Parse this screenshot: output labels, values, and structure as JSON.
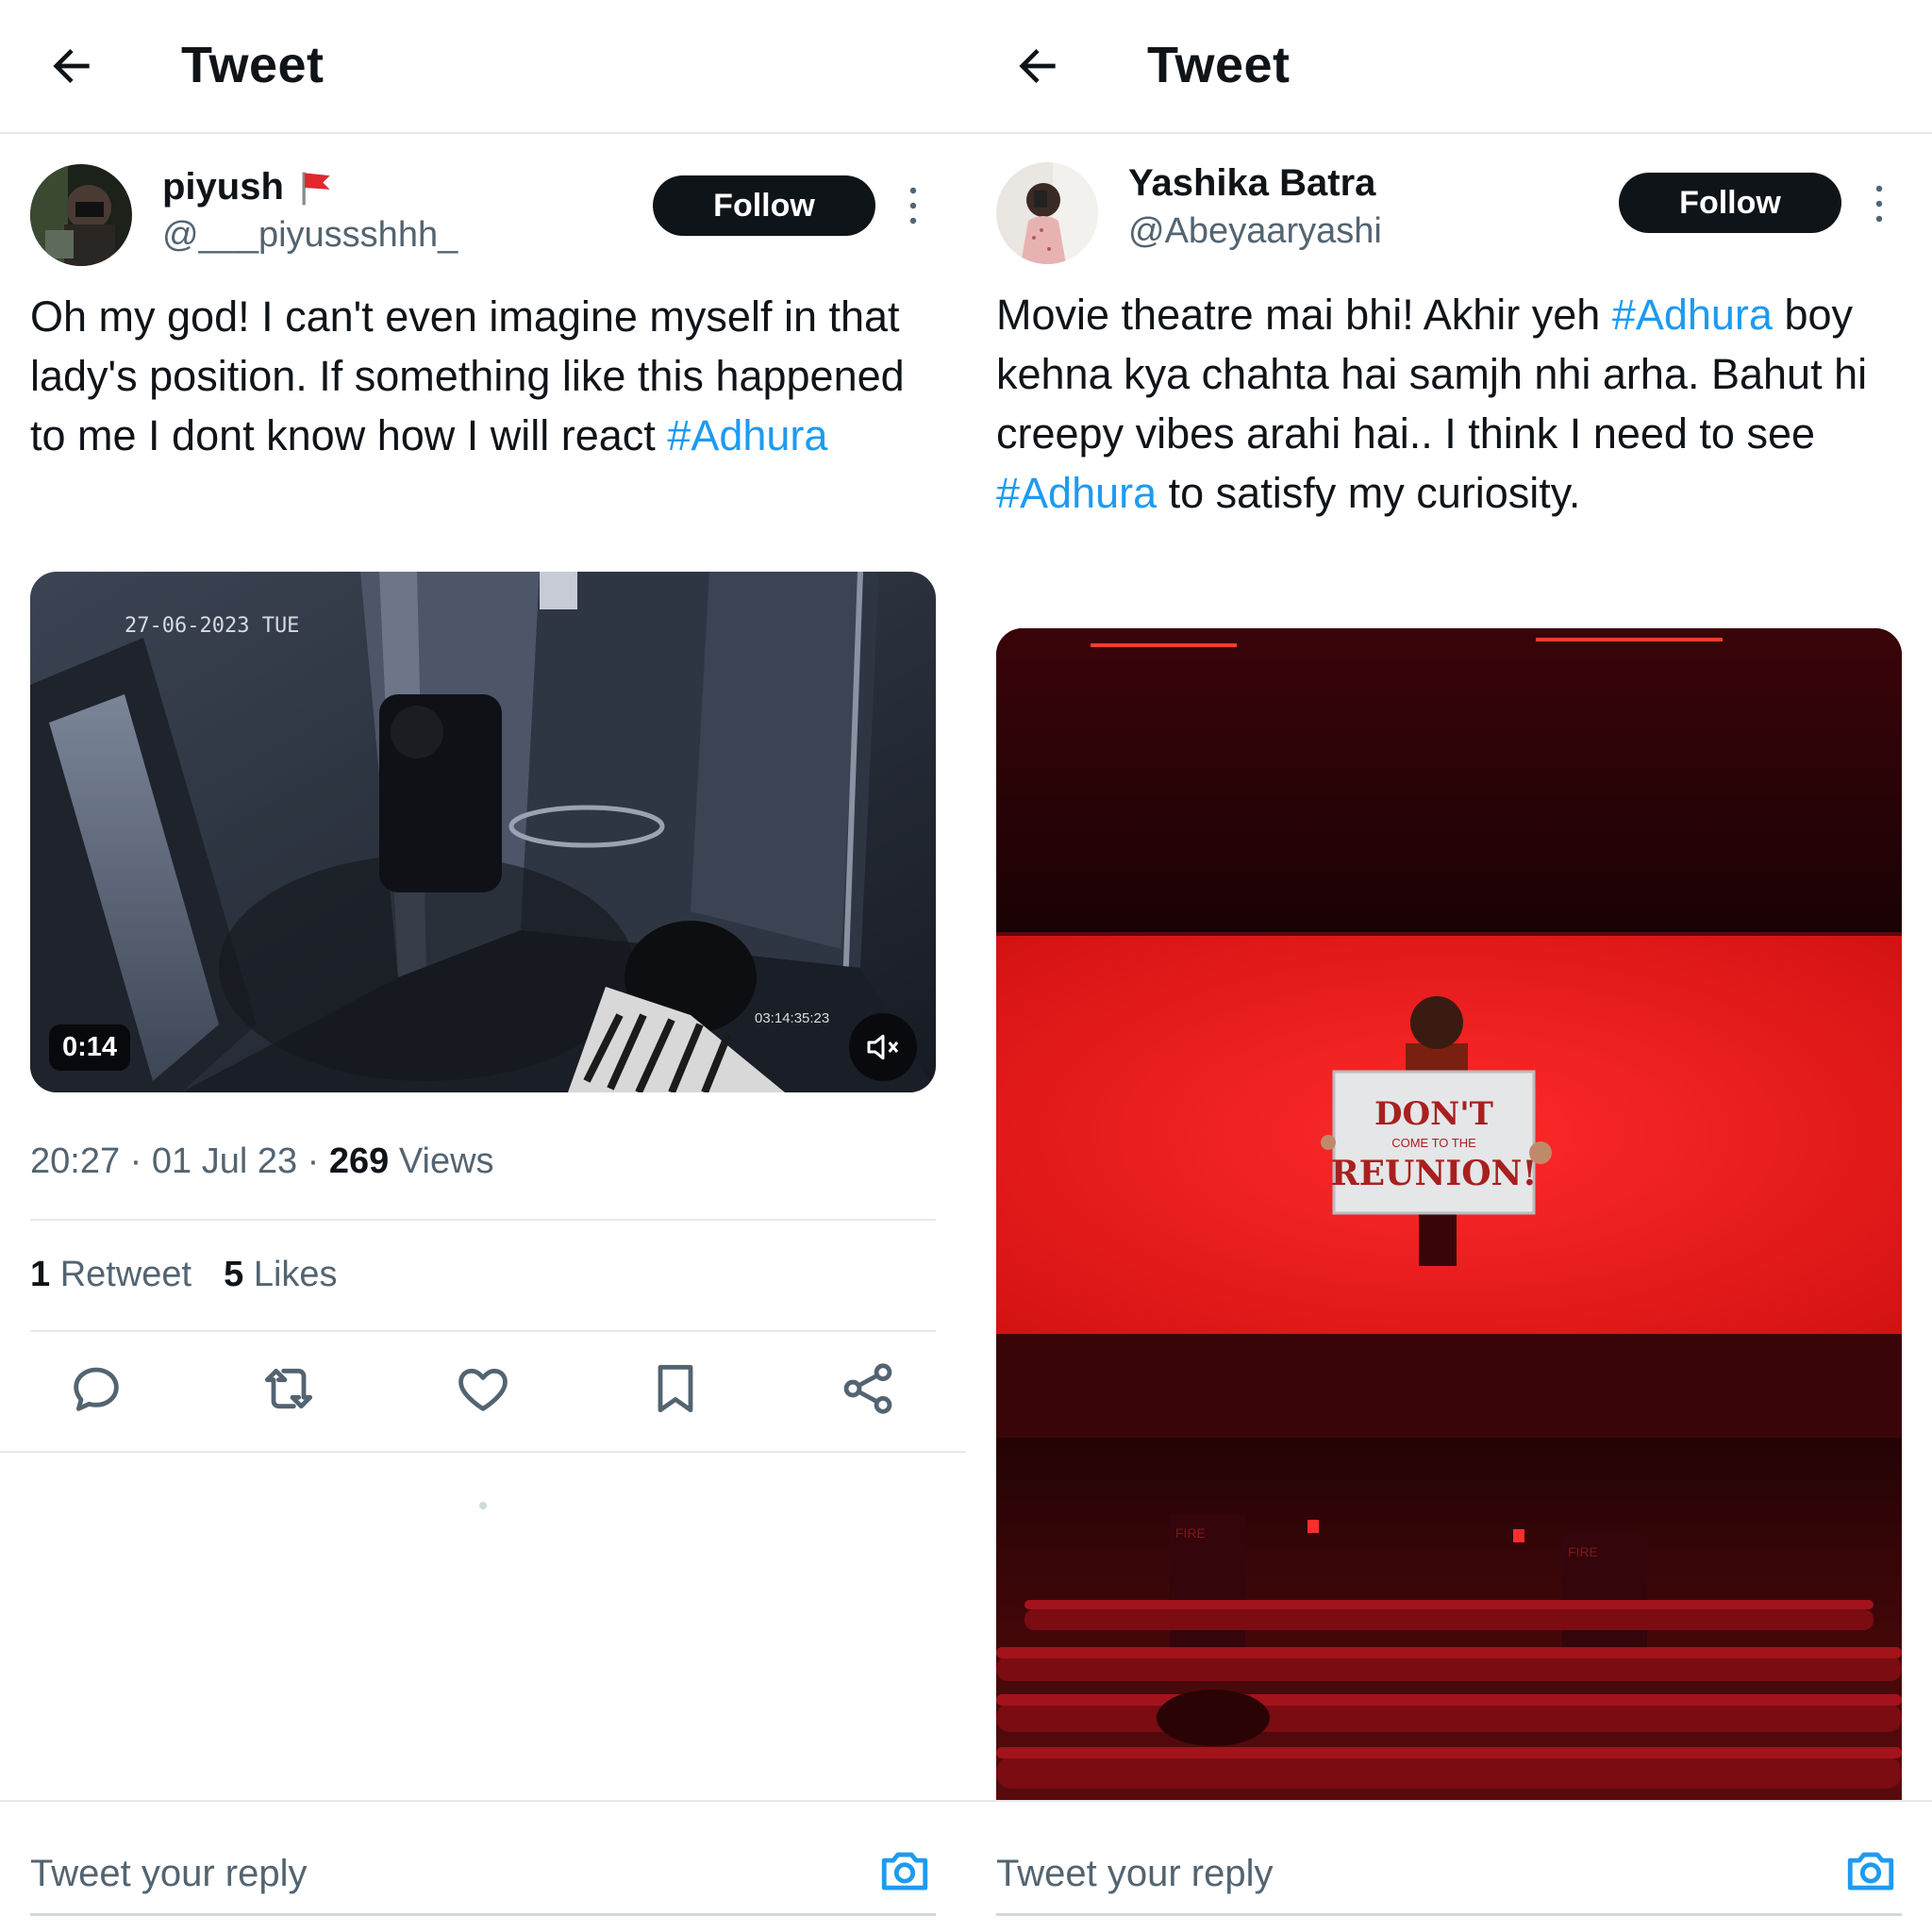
{
  "colors": {
    "accent": "#1d9bf0",
    "text": "#0f1419",
    "muted": "#536471",
    "divider": "#e6e8ea"
  },
  "left": {
    "header": {
      "title": "Tweet",
      "back_icon": "arrow-left-icon"
    },
    "author": {
      "display_name": "piyush",
      "handle": "@___piyussshhh_",
      "badge_icon": "red-flag-icon"
    },
    "follow_label": "Follow",
    "tweet": {
      "text_before": "Oh my god! I can't even imagine myself in that lady's position. If something like this happened to me I dont know how I will react ",
      "hashtag": "#Adhura"
    },
    "video": {
      "duration": "0:14",
      "overlay_date": "27-06-2023 TUE",
      "overlay_time": "03:14:35:23",
      "mute_icon": "speaker-muted-icon"
    },
    "meta": {
      "time": "20:27",
      "date": "01 Jul 23",
      "views_count": "269",
      "views_label": "Views",
      "separator": "·"
    },
    "stats": {
      "retweets_count": "1",
      "retweets_label": "Retweet",
      "likes_count": "5",
      "likes_label": "Likes"
    },
    "actions": [
      "reply-icon",
      "retweet-icon",
      "like-icon",
      "bookmark-icon",
      "share-icon"
    ],
    "reply": {
      "placeholder": "Tweet your reply",
      "camera_icon": "camera-icon"
    }
  },
  "right": {
    "header": {
      "title": "Tweet",
      "back_icon": "arrow-left-icon"
    },
    "author": {
      "display_name": "Yashika Batra",
      "handle": "@Abeyaaryashi"
    },
    "follow_label": "Follow",
    "tweet": {
      "part1": "Movie theatre mai bhi! Akhir yeh ",
      "hashtag1": "#Adhura",
      "part2": " boy kehna kya chahta hai samjh nhi arha. Bahut hi creepy vibes arahi hai.. I think I need to see ",
      "hashtag2": "#Adhura",
      "part3": " to satisfy my curiosity."
    },
    "image": {
      "sign_line1": "DON'T",
      "sign_line2": "COME TO THE",
      "sign_line3": "REUNION!",
      "fire_text": "FIRE"
    },
    "reply": {
      "placeholder": "Tweet your reply",
      "camera_icon": "camera-icon"
    }
  }
}
